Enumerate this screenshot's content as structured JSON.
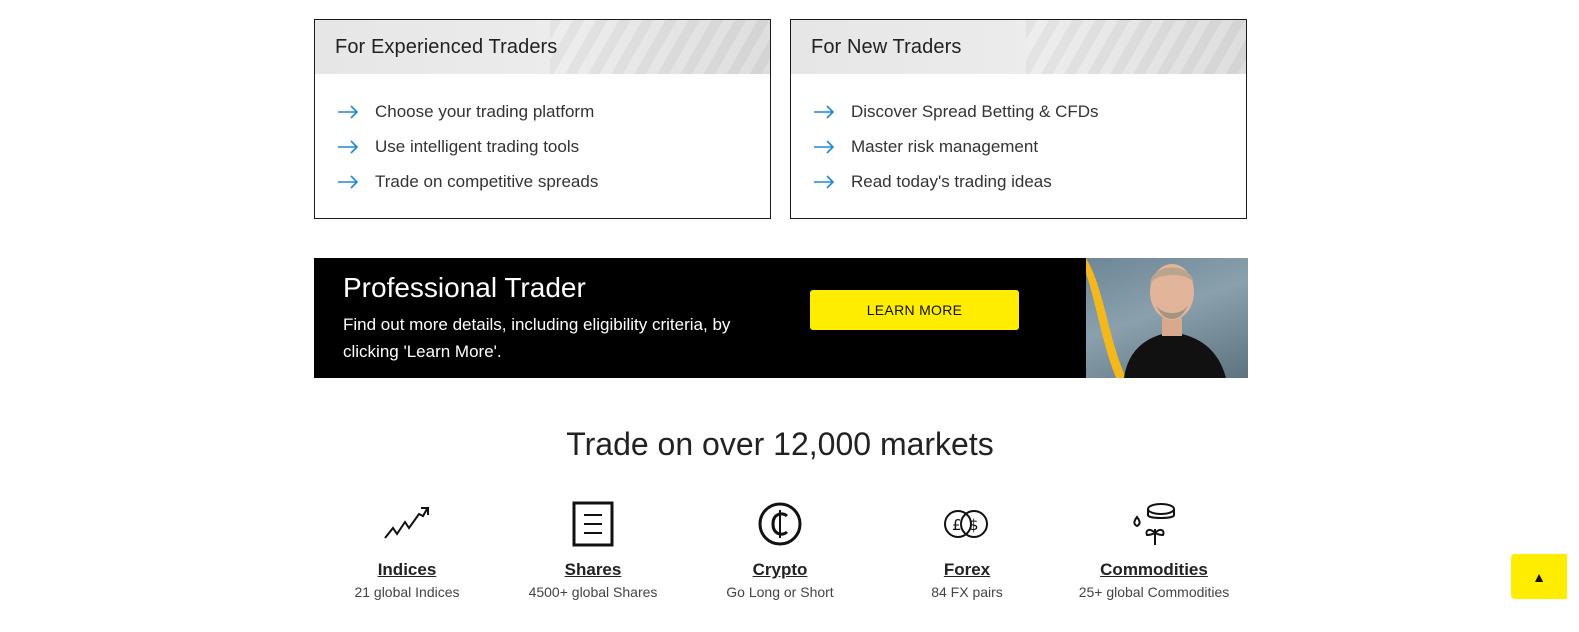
{
  "experienced": {
    "title": "For Experienced Traders",
    "items": [
      "Choose your trading platform",
      "Use intelligent trading tools",
      "Trade on competitive spreads"
    ]
  },
  "new_traders": {
    "title": "For New Traders",
    "items": [
      "Discover Spread Betting & CFDs",
      "Master risk management",
      "Read today's trading ideas"
    ]
  },
  "promo": {
    "title": "Professional Trader",
    "description": "Find out more details, including eligibility criteria, by clicking 'Learn More'.",
    "button_label": "LEARN MORE"
  },
  "markets": {
    "title": "Trade on over 12,000 markets",
    "items": [
      {
        "name": "Indices",
        "sub": "21 global Indices",
        "icon": "trend-up-icon"
      },
      {
        "name": "Shares",
        "sub": "4500+ global Shares",
        "icon": "document-icon"
      },
      {
        "name": "Crypto",
        "sub": "Go Long or Short",
        "icon": "crypto-coin-icon"
      },
      {
        "name": "Forex",
        "sub": "84 FX pairs",
        "icon": "currency-exchange-icon"
      },
      {
        "name": "Commodities",
        "sub": "25+ global Commodities",
        "icon": "commodities-icon"
      }
    ]
  },
  "back_to_top": "▲",
  "colors": {
    "accent_yellow": "#ffed00",
    "arrow_blue": "#1e88d6",
    "promo_bg": "#000000"
  }
}
